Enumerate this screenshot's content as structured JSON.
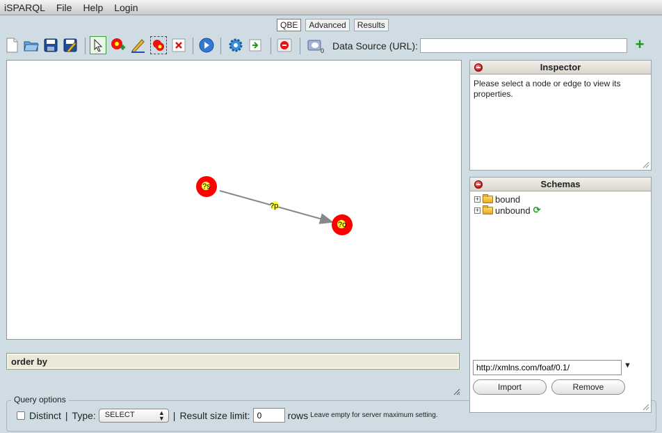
{
  "menu": {
    "items": [
      "iSPARQL",
      "File",
      "Help",
      "Login"
    ]
  },
  "tabs": [
    {
      "label": "QBE",
      "active": true
    },
    {
      "label": "Advanced",
      "active": false
    },
    {
      "label": "Results",
      "active": false
    }
  ],
  "toolbar": {
    "buttons": [
      "new-file-icon",
      "open-folder-icon",
      "save-icon",
      "save-as-icon",
      "select-arrow-icon",
      "add-node-icon",
      "draw-edge-icon",
      "group-icon",
      "delete-icon",
      "run-query-icon",
      "settings-gear-icon",
      "import-icon",
      "stop-icon",
      "datasource-icon"
    ],
    "datasource_count": "0",
    "datasource_label": "Data Source (URL):",
    "datasource_value": ""
  },
  "canvas": {
    "nodes": [
      {
        "label": "?s",
        "color": "#ff0000"
      },
      {
        "label": "?o",
        "color": "#ff0000"
      }
    ],
    "edge": {
      "label": "?p",
      "color": "#888888"
    }
  },
  "order_by": {
    "label": "order by"
  },
  "inspector": {
    "title": "Inspector",
    "message": "Please select a node or edge to view its properties."
  },
  "schemas": {
    "title": "Schemas",
    "tree": [
      "bound",
      "unbound"
    ],
    "url_value": "http://xmlns.com/foaf/0.1/",
    "import_label": "Import",
    "remove_label": "Remove"
  },
  "query_options": {
    "legend": "Query options",
    "distinct_label": "Distinct",
    "type_label": "Type:",
    "type_value": "SELECT",
    "limit_label": "Result size limit:",
    "limit_value": "0",
    "rows_label": "rows",
    "hint": "Leave empty for server maximum setting."
  }
}
